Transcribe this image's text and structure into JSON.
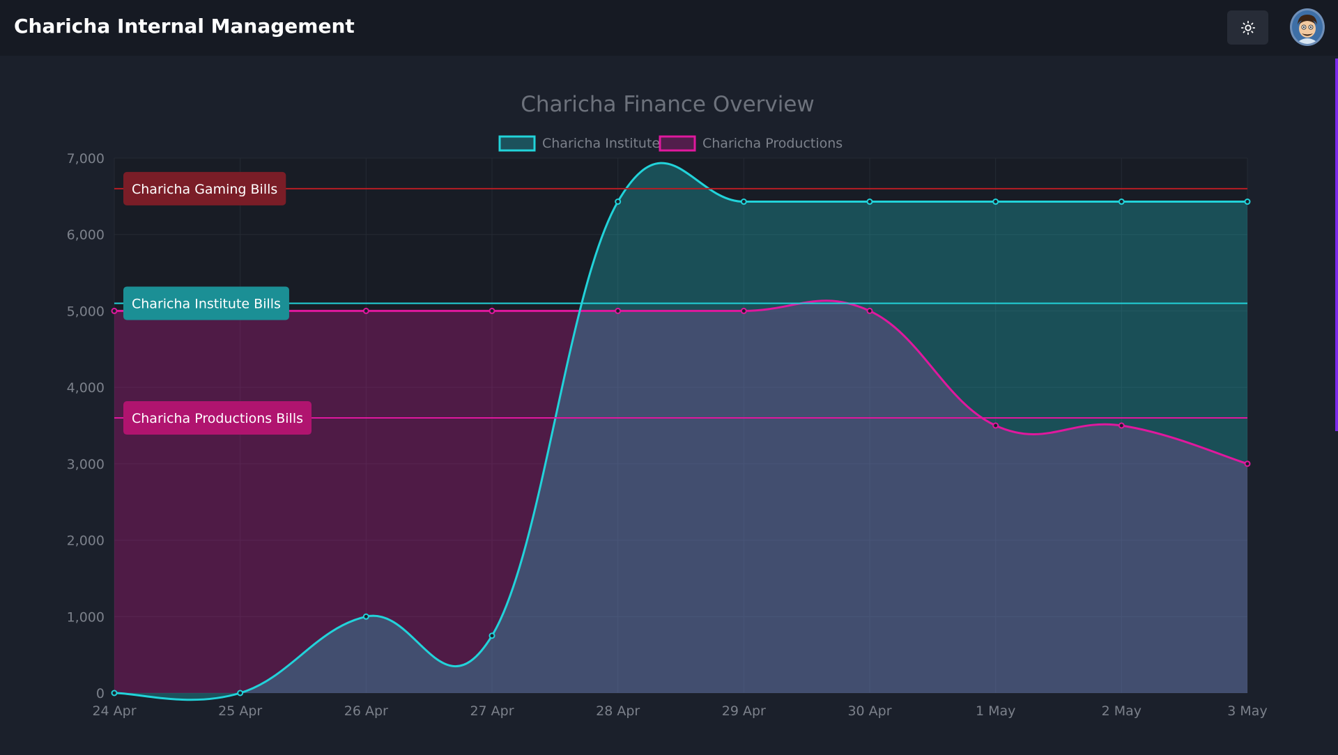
{
  "header": {
    "title": "Charicha Internal Management",
    "theme_toggle_icon": "sun-icon",
    "avatar_icon": "user-avatar"
  },
  "colors": {
    "institute": "#22d3da",
    "productions": "#e0189e",
    "gaming_line": "#b81d24",
    "gaming_label_bg": "#7a1d27",
    "institute_label_bg": "#1b8f95",
    "productions_label_bg": "#b0146f",
    "accent": "#7c2ae8"
  },
  "chart_data": {
    "type": "area",
    "title": "Charicha Finance Overview",
    "categories": [
      "24 Apr",
      "25 Apr",
      "26 Apr",
      "27 Apr",
      "28 Apr",
      "29 Apr",
      "30 Apr",
      "1 May",
      "2 May",
      "3 May"
    ],
    "series": [
      {
        "name": "Charicha Institute",
        "values": [
          0,
          0,
          1000,
          750,
          6430,
          6430,
          6430,
          6430,
          6430,
          6430
        ]
      },
      {
        "name": "Charicha Productions",
        "values": [
          5000,
          5000,
          5000,
          5000,
          5000,
          5000,
          5000,
          3500,
          3500,
          3000
        ]
      }
    ],
    "annotations": [
      {
        "label": "Charicha Gaming Bills",
        "value": 6600,
        "color_key": "gaming"
      },
      {
        "label": "Charicha Institute Bills",
        "value": 5100,
        "color_key": "institute"
      },
      {
        "label": "Charicha Productions Bills",
        "value": 3600,
        "color_key": "productions"
      }
    ],
    "ylim": [
      0,
      7000
    ],
    "yticks": [
      0,
      1000,
      2000,
      3000,
      4000,
      5000,
      6000,
      7000
    ],
    "ytick_labels": [
      "0",
      "1,000",
      "2,000",
      "3,000",
      "4,000",
      "5,000",
      "6,000",
      "7,000"
    ],
    "xlabel": "",
    "ylabel": "",
    "grid": true,
    "legend": "top-center"
  }
}
